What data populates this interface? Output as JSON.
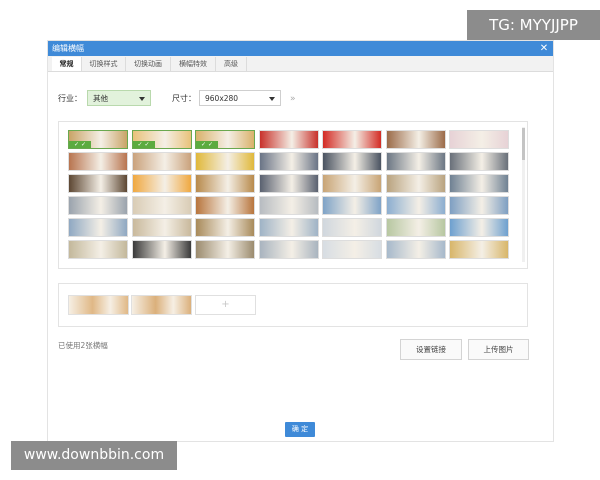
{
  "watermarks": {
    "top": "TG: MYYJJPP",
    "bottom": "www.downbbin.com"
  },
  "dialog": {
    "title": "编辑横幅",
    "close_glyph": "✕",
    "tabs": [
      "常规",
      "切换样式",
      "切换动画",
      "横幅特效",
      "高级"
    ],
    "active_tab": 0
  },
  "filters": {
    "industry_label": "行业：",
    "industry_value": "其他",
    "size_label": "尺寸：",
    "size_value": "960x280",
    "more_glyph": "»"
  },
  "gallery": {
    "rows": [
      [
        "#c9a467",
        "#e8c27a",
        "#d9b26b",
        "#c8312b",
        "#d32b24",
        "#9b6b49",
        "#e7d2d6"
      ],
      [
        "#b8744f",
        "#caa27c",
        "#e0b83a",
        "#6a7486",
        "#4a5361",
        "#6c7784",
        "#69707a"
      ],
      [
        "#5d4733",
        "#f0a840",
        "#b88a4c",
        "#5a6170",
        "#c8a475",
        "#b9a37f",
        "#6f8193"
      ],
      [
        "#9aa3ad",
        "#d9ccb5",
        "#b8753d",
        "#b7bcc1",
        "#7fa3c7",
        "#8caed0",
        "#7e9fc2"
      ],
      [
        "#8fa8c2",
        "#c9b99c",
        "#a88a5a",
        "#9fb3c6",
        "#d0d7de",
        "#b7c7a1",
        "#6ea0cf"
      ],
      [
        "#c3b89b",
        "#3a3a3a",
        "#9b8b6e",
        "#a9b4bf",
        "#d7dde3",
        "#a7b9cb",
        "#d8b66a"
      ]
    ],
    "selected": [
      [
        0,
        0
      ],
      [
        0,
        1
      ],
      [
        0,
        2
      ]
    ],
    "check_glyph": "✓"
  },
  "strip": {
    "slots": [
      "#e0b886",
      "#dbb07b"
    ],
    "add_glyph": "+"
  },
  "footer": {
    "used_text": "已使用2张横幅",
    "set_link_label": "设置链接",
    "upload_label": "上传图片",
    "confirm_label": "确 定"
  }
}
